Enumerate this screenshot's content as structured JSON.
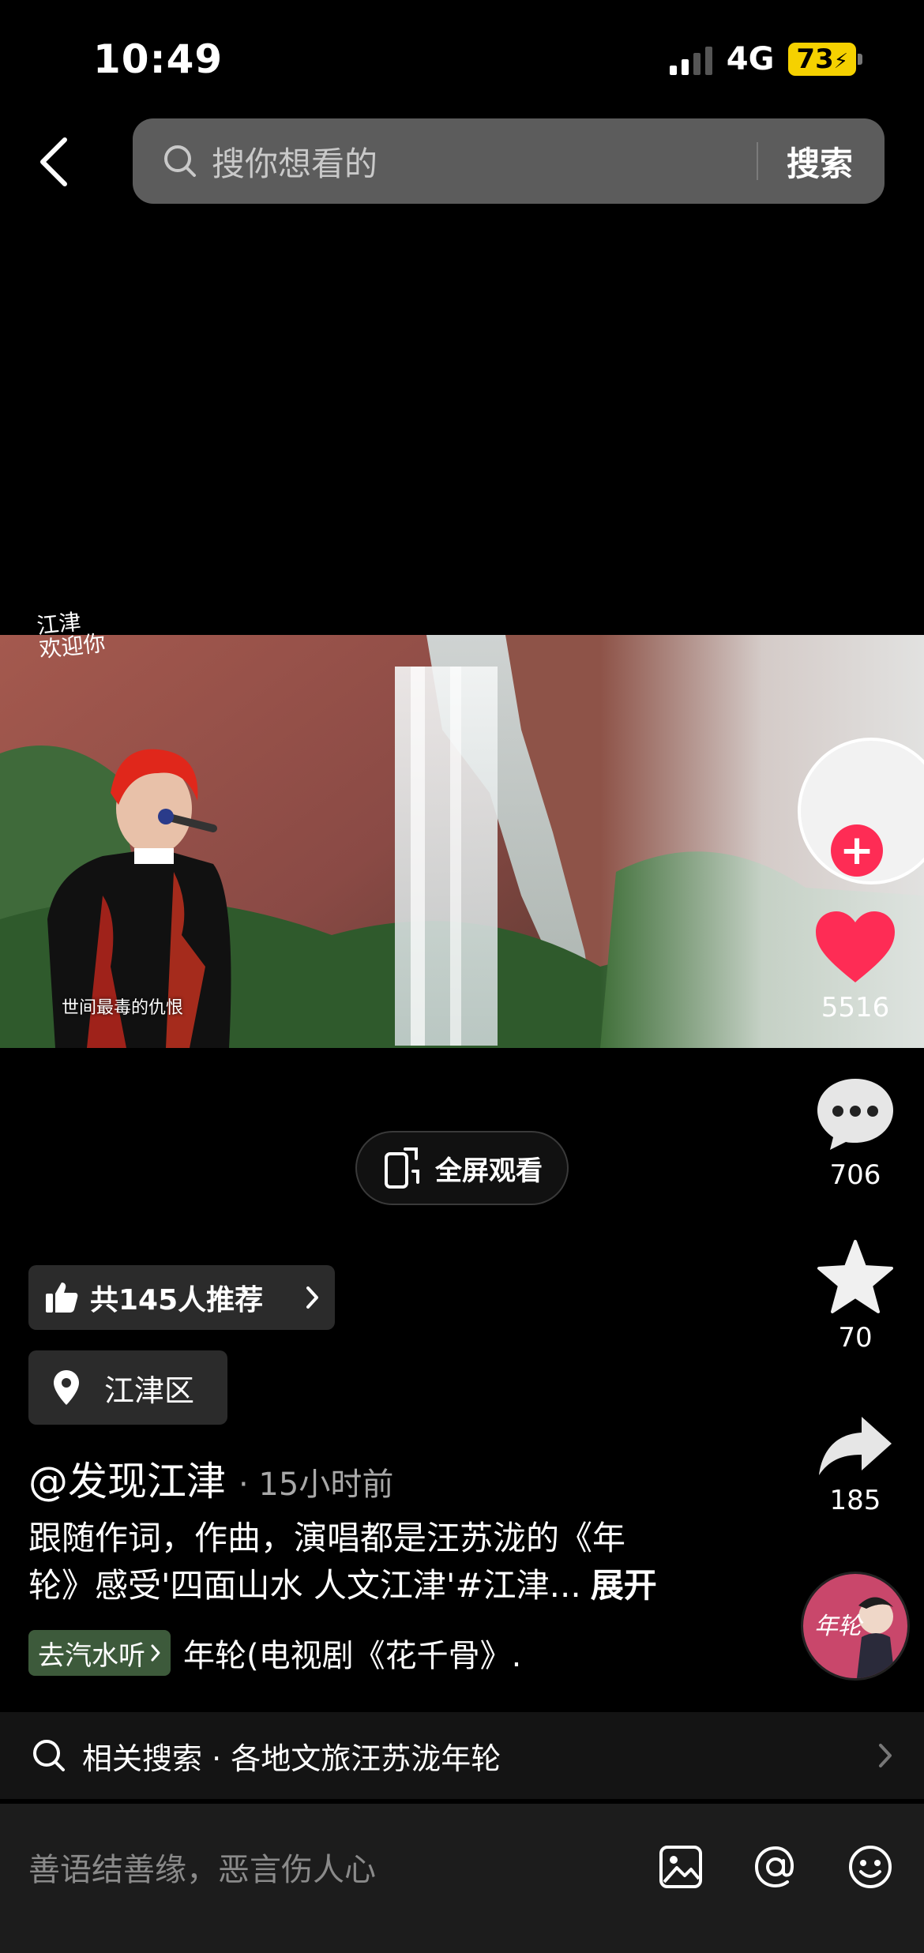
{
  "status": {
    "time": "10:49",
    "network": "4G",
    "battery": "73"
  },
  "search": {
    "placeholder": "搜你想看的",
    "button": "搜索"
  },
  "video": {
    "watermark_line1": "江津",
    "watermark_line2": "欢迎你",
    "subtitle": "世间最毒的仇恨"
  },
  "actions": {
    "likes": "5516",
    "comments": "706",
    "favorites": "70",
    "shares": "185"
  },
  "fullscreen": {
    "label": "全屏观看"
  },
  "recommend": {
    "label": "共145人推荐"
  },
  "location": {
    "label": "江津区"
  },
  "post": {
    "author": "@发现江津",
    "time_ago": "· 15小时前",
    "caption_line1": "跟随作词，作曲，演唱都是汪苏泷的《年",
    "caption_line2": "轮》感受'四面山水 人文江津'#江津...",
    "expand": "展开"
  },
  "music": {
    "chip": "去汽水听",
    "title": "年轮(电视剧《花千骨》."
  },
  "related": {
    "label": "相关搜索 · 各地文旅汪苏泷年轮"
  },
  "comment": {
    "placeholder": "善语结善缘，恶言伤人心"
  },
  "colors": {
    "like_red": "#fe2c55",
    "battery_yellow": "#f5d100",
    "music_chip_green": "#3d5a3b"
  }
}
